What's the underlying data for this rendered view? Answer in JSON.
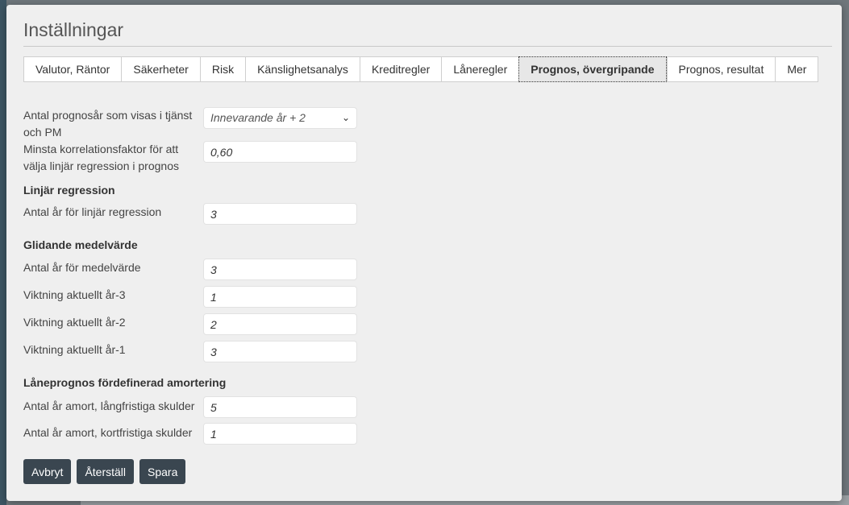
{
  "dialog": {
    "title": "Inställningar"
  },
  "tabs": [
    {
      "label": "Valutor, Räntor"
    },
    {
      "label": "Säkerheter"
    },
    {
      "label": "Risk"
    },
    {
      "label": "Känslighetsanalys"
    },
    {
      "label": "Kreditregler"
    },
    {
      "label": "Låneregler"
    },
    {
      "label": "Prognos, övergripande",
      "active": true
    },
    {
      "label": "Prognos, resultat"
    },
    {
      "label": "Mer"
    }
  ],
  "form": {
    "years_shown": {
      "label": "Antal prognosår som visas i tjänst och PM",
      "value": "Innevarande år + 2"
    },
    "min_correlation": {
      "label": "Minsta korrelationsfaktor för att välja linjär regression i prognos",
      "value": "0,60"
    },
    "linear_section": "Linjär regression",
    "linear_years": {
      "label": "Antal år för linjär regression",
      "value": "3"
    },
    "moving_section": "Glidande medelvärde",
    "avg_years": {
      "label": "Antal år för medelvärde",
      "value": "3"
    },
    "weight_3": {
      "label": "Viktning aktuellt år-3",
      "value": "1"
    },
    "weight_2": {
      "label": "Viktning aktuellt år-2",
      "value": "2"
    },
    "weight_1": {
      "label": "Viktning aktuellt år-1",
      "value": "3"
    },
    "loan_section": "Låneprognos fördefinerad amortering",
    "amort_long": {
      "label": "Antal år amort, långfristiga skulder",
      "value": "5"
    },
    "amort_short": {
      "label": "Antal år amort, kortfristiga skulder",
      "value": "1"
    }
  },
  "buttons": {
    "cancel": "Avbryt",
    "reset": "Återställ",
    "save": "Spara"
  }
}
